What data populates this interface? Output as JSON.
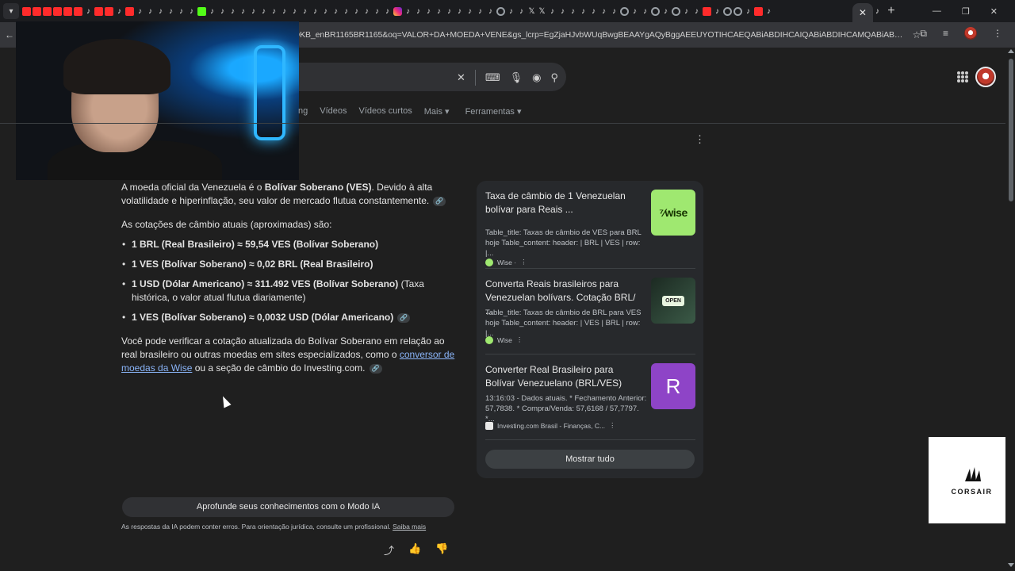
{
  "browser": {
    "tab_menu_icon": "chevron-down-icon",
    "active_tab_close": "✕",
    "new_tab": "+",
    "window_controls": [
      "—",
      "❐",
      "✕"
    ],
    "address_url": "OKB_enBR1165BR1165&oq=VALOR+DA+MOEDA+VENE&gs_lcrp=EgZjaHJvbWUqBwgBEAAYgAQyBggAEEUYOTIHCAEQABiABDIHCAIQABiABDIHCAMQABiABDIICAQQABgWGB4yCAgF..."
  },
  "search": {
    "clear_icon": "✕",
    "tabs": [
      "ng",
      "Vídeos",
      "Vídeos curtos",
      "Mais ▾",
      "Ferramentas ▾"
    ]
  },
  "ai_overview": {
    "intro_pre": "A moeda oficial da Venezuela é o ",
    "intro_bold": "Bolívar Soberano (VES)",
    "intro_post": ". Devido à alta volatilidade e hiperinflação, seu valor de mercado flutua constantemente.",
    "rates_heading": "As cotações de câmbio atuais (aproximadas) são:",
    "rates": [
      {
        "bold": "1 BRL (Real Brasileiro) ≈ 59,54 VES (Bolívar Soberano)",
        "rest": ""
      },
      {
        "bold": "1 VES (Bolívar Soberano) ≈ 0,02 BRL (Real Brasileiro)",
        "rest": ""
      },
      {
        "bold": "1 USD (Dólar Americano) ≈ 311.492 VES (Bolívar Soberano)",
        "rest": " (Taxa histórica, o valor atual flutua diariamente)"
      },
      {
        "bold": "1 VES (Bolívar Soberano) ≈ 0,0032 USD (Dólar Americano)",
        "rest": ""
      }
    ],
    "verify_pre": "Você pode verificar a cotação atualizada do Bolívar Soberano em relação ao real brasileiro ou outras moedas em sites especializados, como o ",
    "verify_link": "conversor de moedas da Wise",
    "verify_post": " ou a seção de câmbio do Investing.com."
  },
  "sources": [
    {
      "title": "Taxa de câmbio de 1 Venezuelan bolívar para Reais ...",
      "snippet": "Table_title: Taxas de câmbio de VES para BRL hoje Table_content: header: | BRL | VES | row: |...",
      "site": "Wise ·",
      "thumb_text": "⁷⁄wise",
      "thumb_color": "#9fe870"
    },
    {
      "title": "Converta Reais brasileiros para Venezuelan bolívars. Cotação BRL/ ...",
      "snippet": "Table_title: Taxas de câmbio de BRL para VES hoje Table_content: header: | VES | BRL | row: |...",
      "site": "Wise",
      "thumb_text": "OPEN",
      "thumb_color": "#2d4a3a"
    },
    {
      "title": "Converter Real Brasileiro para Bolívar Venezuelano (BRL/VES)",
      "snippet": "13:16:03 - Dados atuais. * Fechamento Anterior: 57,7838. * Compra/Venda: 57,6168 / 57,7797. *...",
      "site": "Investing.com Brasil - Finanças, C...",
      "thumb_text": "R",
      "thumb_color": "#8e44c7"
    }
  ],
  "show_all": "Mostrar tudo",
  "deep_dive": "Aprofunde seus conhecimentos com o Modo IA",
  "disclaimer": "As respostas da IA podem conter erros. Para orientação jurídica, consulte um profissional. ",
  "disclaimer_link": "Saiba mais",
  "corsair_word": "CORSAIR"
}
